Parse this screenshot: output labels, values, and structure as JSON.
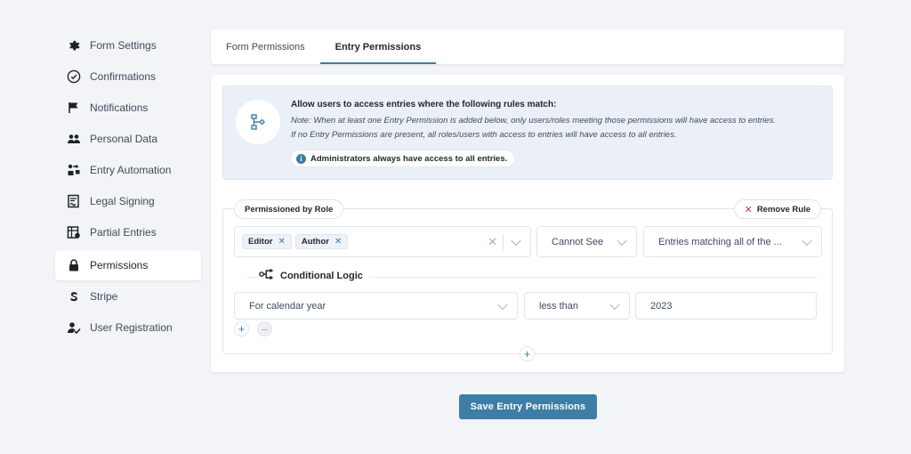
{
  "sidebar": {
    "items": [
      {
        "label": "Form Settings",
        "icon": "gear-icon"
      },
      {
        "label": "Confirmations",
        "icon": "check-circle-icon"
      },
      {
        "label": "Notifications",
        "icon": "flag-icon"
      },
      {
        "label": "Personal Data",
        "icon": "users-icon"
      },
      {
        "label": "Entry Automation",
        "icon": "automation-icon"
      },
      {
        "label": "Legal Signing",
        "icon": "signature-icon"
      },
      {
        "label": "Partial Entries",
        "icon": "partial-entries-icon"
      },
      {
        "label": "Permissions",
        "icon": "lock-icon"
      },
      {
        "label": "Stripe",
        "icon": "stripe-icon"
      },
      {
        "label": "User Registration",
        "icon": "user-check-icon"
      }
    ],
    "active": "Permissions"
  },
  "tabs": [
    {
      "label": "Form Permissions"
    },
    {
      "label": "Entry Permissions"
    }
  ],
  "active_tab": "Entry Permissions",
  "info": {
    "title": "Allow users to access entries where the following rules match:",
    "note_line1": "Note: When at least one Entry Permission is added below, only users/roles meeting those permissions will have access to entries.",
    "note_line2": "If no Entry Permissions are present, all roles/users with access to entries will have access to all entries.",
    "admin_badge": "Administrators always have access to all entries."
  },
  "rule": {
    "title": "Permissioned by Role",
    "remove_label": "Remove Rule",
    "roles": [
      "Editor",
      "Author"
    ],
    "visibility": "Cannot See",
    "match": "Entries matching all of the ...",
    "conditional_label": "Conditional Logic",
    "condition": {
      "field": "For calendar year",
      "operator": "less than",
      "value": "2023"
    }
  },
  "save_button": "Save Entry Permissions",
  "colors": {
    "accent": "#3e7da6",
    "background": "#f2f4f7",
    "danger": "#d63638"
  }
}
